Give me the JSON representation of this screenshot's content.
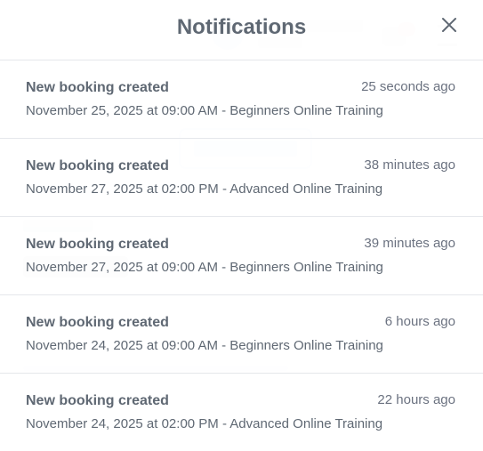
{
  "panel": {
    "title": "Notifications",
    "close_icon": "close-icon"
  },
  "notifications": [
    {
      "title": "New booking created",
      "time": "25 seconds ago",
      "detail": "November 25, 2025 at 09:00 AM - Beginners Online Training"
    },
    {
      "title": "New booking created",
      "time": "38 minutes ago",
      "detail": "November 27, 2025 at 02:00 PM - Advanced Online Training"
    },
    {
      "title": "New booking created",
      "time": "39 minutes ago",
      "detail": "November 27, 2025 at 09:00 AM - Beginners Online Training"
    },
    {
      "title": "New booking created",
      "time": "6 hours ago",
      "detail": "November 24, 2025 at 09:00 AM - Beginners Online Training"
    },
    {
      "title": "New booking created",
      "time": "22 hours ago",
      "detail": "November 24, 2025 at 02:00 PM - Advanced Online Training"
    }
  ],
  "colors": {
    "title_text": "#5f6873",
    "time_text": "#6b7280",
    "divider": "#e5e7eb",
    "background": "#ffffff"
  }
}
